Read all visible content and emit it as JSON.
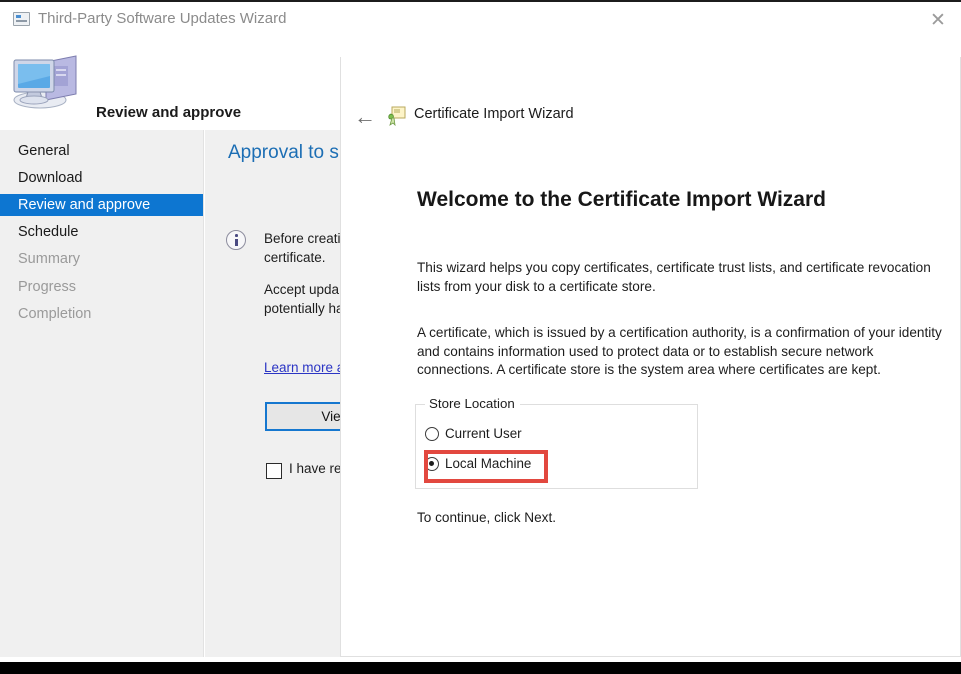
{
  "window": {
    "title": "Third-Party Software Updates Wizard",
    "title_icon": "wizard-window-icon",
    "close_label": "✕",
    "header_title": "Review and approve",
    "header_icon": "computer-monitor-icon"
  },
  "sidebar": {
    "items": [
      {
        "label": "General",
        "state": "normal"
      },
      {
        "label": "Download",
        "state": "normal"
      },
      {
        "label": "Review and approve",
        "state": "selected"
      },
      {
        "label": "Schedule",
        "state": "normal"
      },
      {
        "label": "Summary",
        "state": "disabled"
      },
      {
        "label": "Progress",
        "state": "disabled"
      },
      {
        "label": "Completion",
        "state": "disabled"
      }
    ],
    "selected_color": "#0d76d1",
    "background_color": "#f0f0f0"
  },
  "background_panel": {
    "heading": "Approval to s",
    "heading_color": "#1c6eb4",
    "info_icon": "info-circle-icon",
    "paragraph_1": "Before creati\ncertificate.",
    "paragraph_2": "Accept upda\npotentially ha",
    "link_text": "Learn more a",
    "button_label": "View (",
    "checkbox_label": "I have re",
    "checkbox_checked": false
  },
  "cert_dialog": {
    "back_arrow": "←",
    "header_icon": "certificate-icon",
    "header_title": "Certificate Import Wizard",
    "welcome_heading": "Welcome to the Certificate Import Wizard",
    "paragraph_1": "This wizard helps you copy certificates, certificate trust lists, and certificate revocation lists from your disk to a certificate store.",
    "paragraph_2": "A certificate, which is issued by a certification authority, is a confirmation of your identity and contains information used to protect data or to establish secure network connections. A certificate store is the system area where certificates are kept.",
    "next_line": "To continue, click Next.",
    "store_location": {
      "legend": "Store Location",
      "options": [
        {
          "label": "Current User",
          "selected": false
        },
        {
          "label": "Local Machine",
          "selected": true
        }
      ]
    }
  },
  "annotation": {
    "highlight_color": "#e2483f",
    "target": "Local Machine"
  }
}
